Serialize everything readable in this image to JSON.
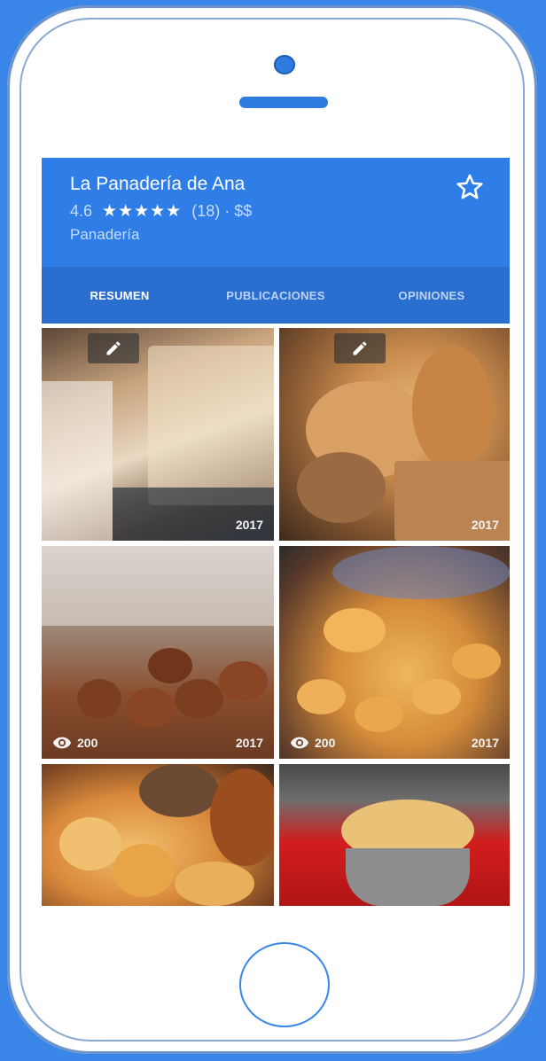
{
  "place": {
    "name": "La Panadería de Ana",
    "rating": "4.6",
    "stars": "★★★★★",
    "reviews_and_price": "(18) · $$",
    "category": "Panadería"
  },
  "tabs": [
    {
      "label": "RESUMEN",
      "active": true
    },
    {
      "label": "PUBLICACIONES",
      "active": false
    },
    {
      "label": "OPINIONES",
      "active": false
    }
  ],
  "photos": [
    {
      "year": "2017",
      "views": "",
      "editable": true,
      "icon": "edit-icon"
    },
    {
      "year": "2017",
      "views": "",
      "editable": true,
      "icon": "edit-icon"
    },
    {
      "year": "2017",
      "views": "200",
      "editable": false,
      "icon": "eye-icon"
    },
    {
      "year": "2017",
      "views": "200",
      "editable": false,
      "icon": "eye-icon"
    },
    {
      "year": "",
      "views": "",
      "editable": false
    },
    {
      "year": "",
      "views": "",
      "editable": false
    }
  ],
  "colors": {
    "header": "#2f7ee8",
    "tabs_bar": "#2a6fd0",
    "frame_background": "#3a86e8"
  }
}
